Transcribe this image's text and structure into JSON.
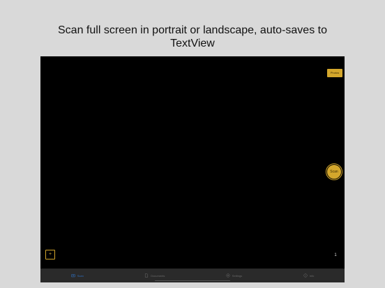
{
  "caption": {
    "line1": "Scan full screen in portrait or landscape, auto-saves to",
    "line2": "TextView"
  },
  "camera": {
    "photos_label": "Photos",
    "scan_label": "Scan",
    "add_label": "+",
    "page_count": "1"
  },
  "tabbar": {
    "tabs": [
      {
        "label": "Scan",
        "icon": "camera-icon",
        "active": true
      },
      {
        "label": "Documents",
        "icon": "document-icon",
        "active": false
      },
      {
        "label": "Settings",
        "icon": "gear-icon",
        "active": false
      },
      {
        "label": "Info",
        "icon": "info-icon",
        "active": false
      }
    ]
  },
  "colors": {
    "accent": "#d4a72c",
    "active_tab": "#2f6fbe",
    "background": "#d9d9d9",
    "camera_bg": "#000000"
  }
}
